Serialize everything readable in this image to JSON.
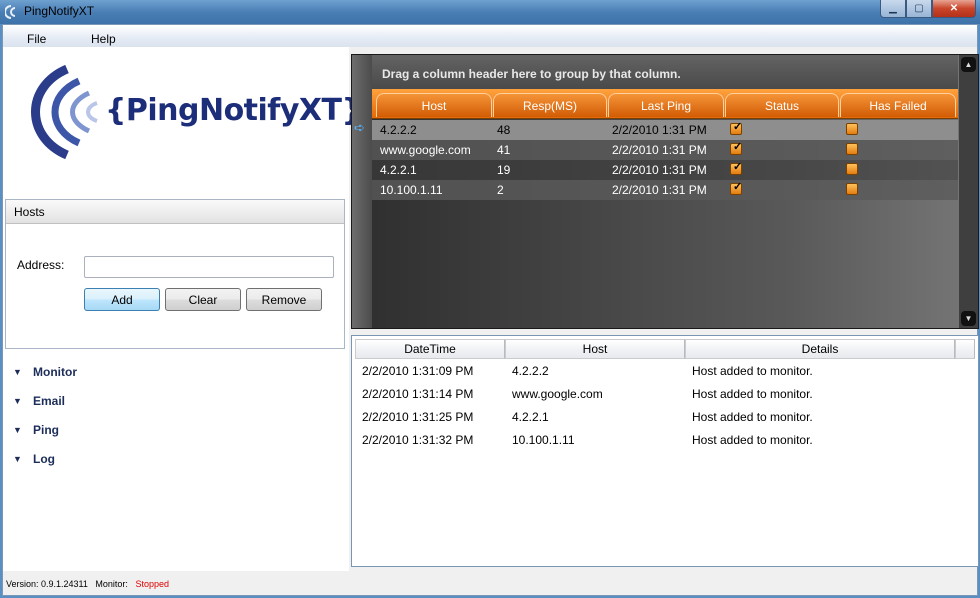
{
  "window": {
    "title": "PingNotifyXT"
  },
  "menu": [
    {
      "label": "File"
    },
    {
      "label": "Help"
    }
  ],
  "logo": {
    "text": "{PingNotifyXT}"
  },
  "hosts": {
    "header": "Hosts",
    "address_label": "Address:",
    "address_value": "",
    "add_label": "Add",
    "clear_label": "Clear",
    "remove_label": "Remove"
  },
  "sections": [
    {
      "label": "Monitor"
    },
    {
      "label": "Email"
    },
    {
      "label": "Ping"
    },
    {
      "label": "Log"
    }
  ],
  "grid": {
    "group_hint": "Drag a column header here to group by that column.",
    "columns": [
      "Host",
      "Resp(MS)",
      "Last Ping",
      "Status",
      "Has Failed"
    ],
    "rows": [
      {
        "host": "4.2.2.2",
        "resp": "48",
        "last_ping": "2/2/2010 1:31 PM",
        "status": true,
        "has_failed": false
      },
      {
        "host": "www.google.com",
        "resp": "41",
        "last_ping": "2/2/2010 1:31 PM",
        "status": true,
        "has_failed": false
      },
      {
        "host": "4.2.2.1",
        "resp": "19",
        "last_ping": "2/2/2010 1:31 PM",
        "status": true,
        "has_failed": false
      },
      {
        "host": "10.100.1.11",
        "resp": "2",
        "last_ping": "2/2/2010 1:31 PM",
        "status": true,
        "has_failed": false
      }
    ]
  },
  "log": {
    "columns": [
      "DateTime",
      "Host",
      "Details"
    ],
    "rows": [
      {
        "datetime": "2/2/2010 1:31:09 PM",
        "host": "4.2.2.2",
        "details": "Host added to monitor."
      },
      {
        "datetime": "2/2/2010 1:31:14 PM",
        "host": "www.google.com",
        "details": "Host added to monitor."
      },
      {
        "datetime": "2/2/2010 1:31:25 PM",
        "host": "4.2.2.1",
        "details": "Host added to monitor."
      },
      {
        "datetime": "2/2/2010 1:31:32 PM",
        "host": "10.100.1.11",
        "details": "Host added to monitor."
      }
    ]
  },
  "status": {
    "version_label": "Version: 0.9.1.24311",
    "monitor_label": "Monitor:",
    "monitor_state": "Stopped",
    "stopped_color": "#e00000"
  }
}
